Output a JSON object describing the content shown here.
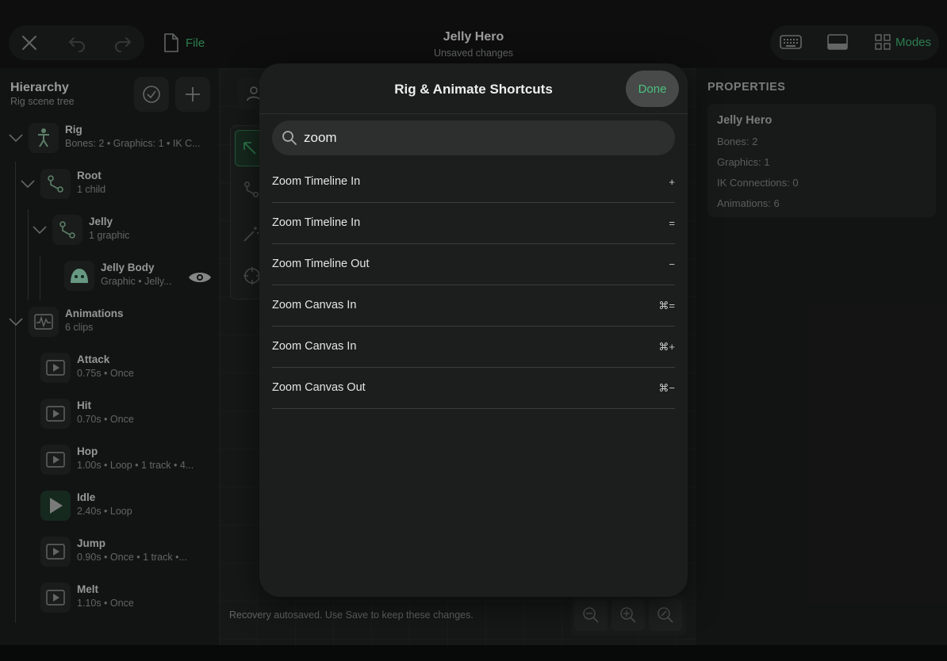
{
  "topbar": {
    "file_label": "File",
    "title": "Jelly Hero",
    "subtitle": "Unsaved changes",
    "modes_label": "Modes"
  },
  "sidebar": {
    "title": "Hierarchy",
    "subtitle": "Rig scene tree",
    "tree": [
      {
        "name": "Rig",
        "meta": "Bones: 2  •  Graphics: 1  •  IK C..."
      },
      {
        "name": "Root",
        "meta": "1 child"
      },
      {
        "name": "Jelly",
        "meta": "1 graphic"
      },
      {
        "name": "Jelly Body",
        "meta": "Graphic  •  Jelly..."
      },
      {
        "name": "Animations",
        "meta": "6 clips"
      }
    ],
    "clips": [
      {
        "name": "Attack",
        "meta": "0.75s  •  Once"
      },
      {
        "name": "Hit",
        "meta": "0.70s  •  Once"
      },
      {
        "name": "Hop",
        "meta": "1.00s  •  Loop  •  1 track  •  4..."
      },
      {
        "name": "Idle",
        "meta": "2.40s  •  Loop"
      },
      {
        "name": "Jump",
        "meta": "0.90s  •  Once  •  1 track  •..."
      },
      {
        "name": "Melt",
        "meta": "1.10s  •  Once"
      }
    ]
  },
  "canvas": {
    "recovery_text": "Recovery autosaved. Use Save to keep these changes."
  },
  "properties": {
    "header": "PROPERTIES",
    "name": "Jelly Hero",
    "rows": [
      "Bones: 2",
      "Graphics: 1",
      "IK Connections: 0",
      "Animations: 6"
    ]
  },
  "modal": {
    "title": "Rig & Animate Shortcuts",
    "done_label": "Done",
    "search_value": "zoom",
    "shortcuts": [
      {
        "label": "Zoom Timeline In",
        "key": "+"
      },
      {
        "label": "Zoom Timeline In",
        "key": "="
      },
      {
        "label": "Zoom Timeline Out",
        "key": "−"
      },
      {
        "label": "Zoom Canvas In",
        "key": "⌘="
      },
      {
        "label": "Zoom Canvas In",
        "key": "⌘+"
      },
      {
        "label": "Zoom Canvas Out",
        "key": "⌘−"
      }
    ]
  },
  "colors": {
    "accent": "#3fae6e",
    "done_text": "#4cc07f",
    "background": "#0f1110",
    "modal": "#1c1e1d"
  },
  "icons": {
    "close": "close-icon",
    "undo": "undo-icon",
    "redo": "redo-icon",
    "file": "file-icon",
    "keyboard": "keyboard-icon",
    "panel": "panel-icon",
    "modes": "grid-icon",
    "search": "search-icon"
  }
}
